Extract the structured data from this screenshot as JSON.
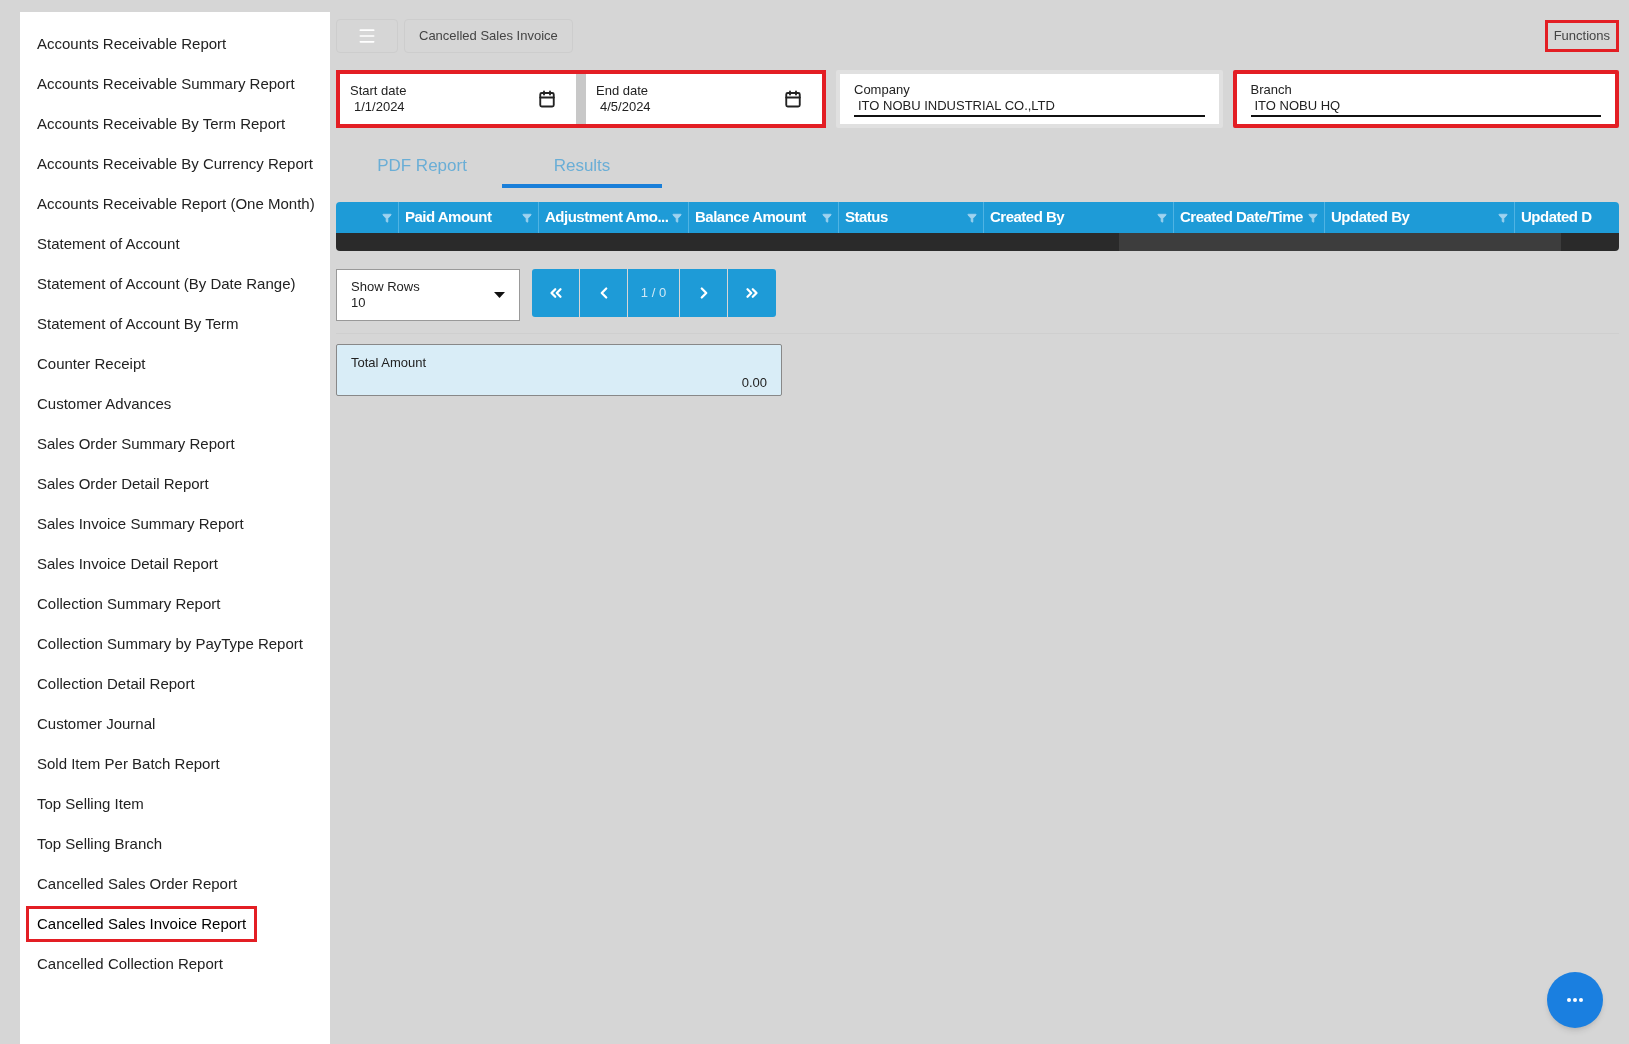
{
  "sidebar": {
    "items": [
      {
        "label": "Accounts Receivable Report",
        "selected": false,
        "highlighted": false
      },
      {
        "label": "Accounts Receivable Summary Report",
        "selected": false,
        "highlighted": false
      },
      {
        "label": "Accounts Receivable By Term Report",
        "selected": false,
        "highlighted": false
      },
      {
        "label": "Accounts Receivable By Currency Report",
        "selected": false,
        "highlighted": false
      },
      {
        "label": "Accounts Receivable Report (One Month)",
        "selected": false,
        "highlighted": false
      },
      {
        "label": "Statement of Account",
        "selected": false,
        "highlighted": false
      },
      {
        "label": "Statement of Account (By Date Range)",
        "selected": false,
        "highlighted": false
      },
      {
        "label": "Statement of Account By Term",
        "selected": false,
        "highlighted": false
      },
      {
        "label": "Counter Receipt",
        "selected": false,
        "highlighted": false
      },
      {
        "label": "Customer Advances",
        "selected": false,
        "highlighted": false
      },
      {
        "label": "Sales Order Summary Report",
        "selected": false,
        "highlighted": false
      },
      {
        "label": "Sales Order Detail Report",
        "selected": false,
        "highlighted": false
      },
      {
        "label": "Sales Invoice Summary Report",
        "selected": false,
        "highlighted": false
      },
      {
        "label": "Sales Invoice Detail Report",
        "selected": false,
        "highlighted": false
      },
      {
        "label": "Collection Summary Report",
        "selected": false,
        "highlighted": false
      },
      {
        "label": "Collection Summary by PayType Report",
        "selected": false,
        "highlighted": false
      },
      {
        "label": "Collection Detail Report",
        "selected": false,
        "highlighted": false
      },
      {
        "label": "Customer Journal",
        "selected": false,
        "highlighted": false
      },
      {
        "label": "Sold Item Per Batch Report",
        "selected": false,
        "highlighted": false
      },
      {
        "label": "Top Selling Item",
        "selected": false,
        "highlighted": false
      },
      {
        "label": "Top Selling Branch",
        "selected": false,
        "highlighted": false
      },
      {
        "label": "Cancelled Sales Order Report",
        "selected": false,
        "highlighted": false
      },
      {
        "label": "Cancelled Sales Invoice Report",
        "selected": true,
        "highlighted": true
      },
      {
        "label": "Cancelled Collection Report",
        "selected": false,
        "highlighted": false
      }
    ]
  },
  "toolbar": {
    "title": "Cancelled Sales Invoice",
    "functions": {
      "label": "Functions",
      "highlighted": true
    }
  },
  "date_range": {
    "highlighted": true,
    "fields": [
      {
        "label": "Start date",
        "value": "1/1/2024"
      },
      {
        "label": "End date",
        "value": "4/5/2024"
      }
    ]
  },
  "filters": [
    {
      "label": "Company",
      "value": "ITO NOBU INDUSTRIAL CO.,LTD",
      "highlighted": false
    },
    {
      "label": "Branch",
      "value": "ITO NOBU HQ",
      "highlighted": true
    }
  ],
  "tabs": [
    {
      "label": "PDF Report",
      "selected": false
    },
    {
      "label": "Results",
      "selected": true
    }
  ],
  "table": {
    "columns": [
      "",
      "Paid Amount",
      "Adjustment Amo...",
      "Balance Amount",
      "Status",
      "Created By",
      "Created Date/Time",
      "Updated By",
      "Updated D"
    ]
  },
  "pagination": {
    "show_rows_label": "Show Rows",
    "show_rows_value": "10",
    "page": "1 / 0"
  },
  "total": {
    "label": "Total Amount",
    "value": "0.00"
  }
}
